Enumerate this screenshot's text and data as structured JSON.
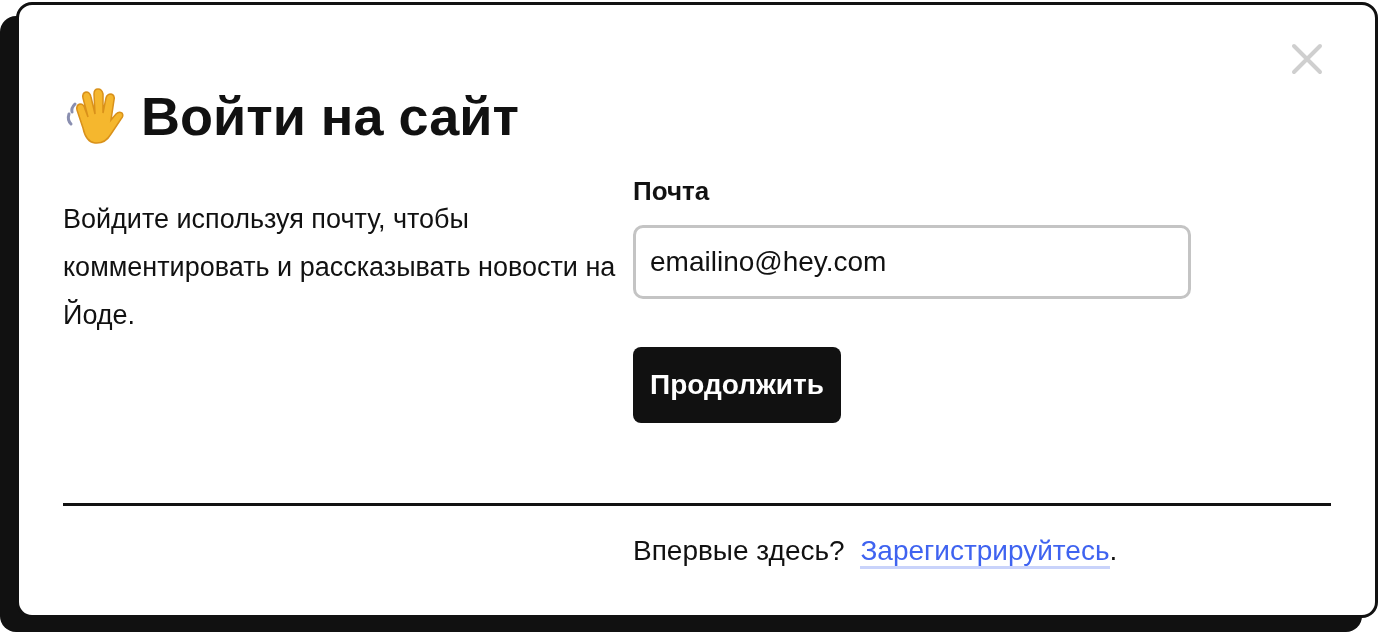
{
  "dialog": {
    "title": "Войти на сайт",
    "description": "Войдите используя почту, чтобы комментировать и рассказывать новости на Йоде.",
    "email": {
      "label": "Почта",
      "value": "emailino@hey.com"
    },
    "button": "Продолжить",
    "footer": {
      "prompt": "Впервые здесь?",
      "link": "Зарегистрируйтесь",
      "end": "."
    }
  }
}
